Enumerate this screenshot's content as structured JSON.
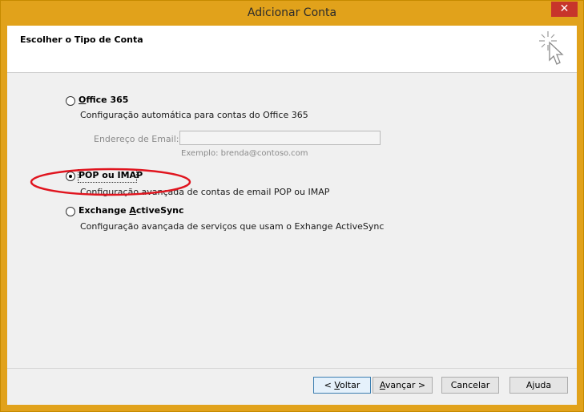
{
  "window": {
    "title": "Adicionar Conta",
    "close_glyph": "✕"
  },
  "header": {
    "title": "Escolher o Tipo de Conta",
    "icon": "cursor-sparkle-icon"
  },
  "options": {
    "office365": {
      "label": "Office 365",
      "description": "Configuração automática para contas do Office 365",
      "selected": false
    },
    "email": {
      "label": "Endereço de Email:",
      "value": "",
      "hint": "Exemplo: brenda@contoso.com"
    },
    "pop_imap": {
      "label": "POP ou IMAP",
      "description": "Configuração avançada de contas de email POP ou IMAP",
      "selected": true
    },
    "exchange": {
      "label_pre": "Exchange ",
      "label_access": "A",
      "label_post": "ctiveSync",
      "description": "Configuração avançada de serviços que usam o Exhange ActiveSync",
      "selected": false
    }
  },
  "annotation": {
    "color": "#e0141e"
  },
  "buttons": {
    "back": {
      "pre": "< ",
      "access": "V",
      "post": "oltar"
    },
    "next": {
      "pre": "",
      "access": "A",
      "post": "vançar >"
    },
    "cancel": "Cancelar",
    "help": "Ajuda"
  },
  "colors": {
    "titlebar": "#e1a21b",
    "close": "#c7352b"
  }
}
